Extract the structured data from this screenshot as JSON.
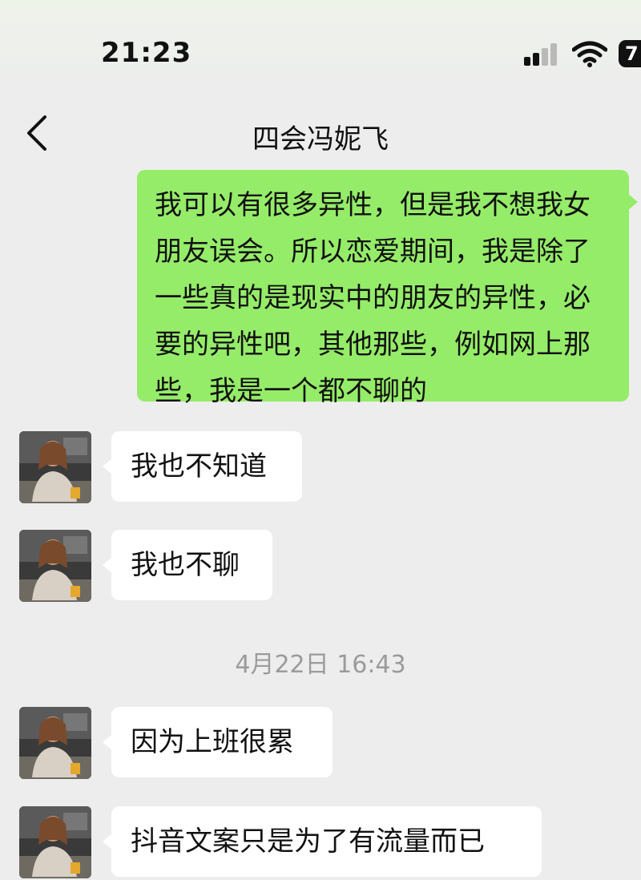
{
  "status_bar": {
    "time": "21:23",
    "battery": "7"
  },
  "chat": {
    "title": "四会冯妮飞",
    "messages": [
      {
        "direction": "outgoing",
        "text": "我可以有很多异性，但是我不想我女朋友误会。所以恋爱期间，我是除了一些真的是现实中的朋友的异性，必要的异性吧，其他那些，例如网上那些，我是一个都不聊的"
      },
      {
        "direction": "incoming",
        "text": "我也不知道"
      },
      {
        "direction": "incoming",
        "text": "我也不聊"
      },
      {
        "type": "timestamp",
        "text": "4月22日 16:43"
      },
      {
        "direction": "incoming",
        "text": "因为上班很累"
      },
      {
        "direction": "incoming",
        "text": "抖音文案只是为了有流量而已"
      }
    ]
  },
  "colors": {
    "background": "#ededed",
    "outgoing_bubble": "#95ec69",
    "incoming_bubble": "#ffffff",
    "timestamp_text": "#9b9b9b"
  },
  "icons": {
    "back": "chevron-left-icon",
    "signal": "cellular-signal-icon",
    "wifi": "wifi-icon",
    "battery": "battery-icon"
  }
}
